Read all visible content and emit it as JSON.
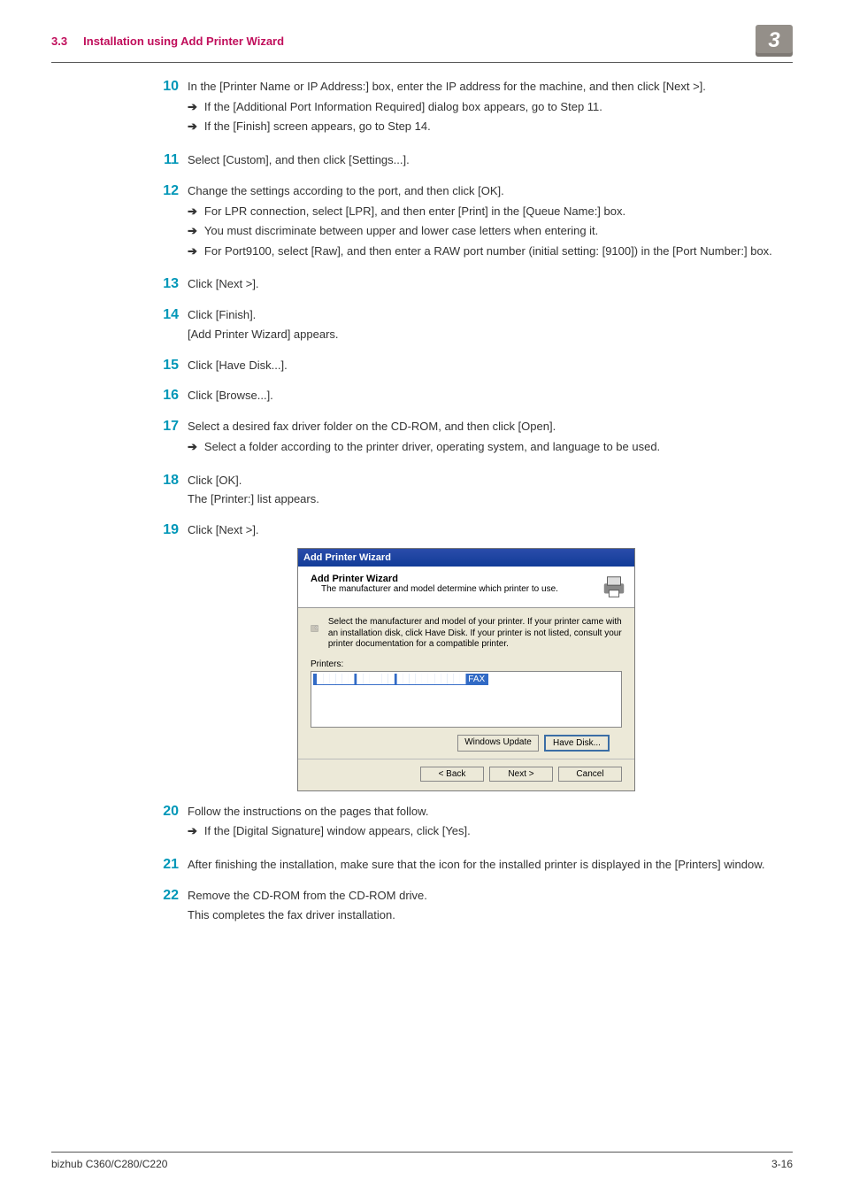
{
  "header": {
    "section_no": "3.3",
    "section_title": "Installation using Add Printer Wizard",
    "chapter": "3"
  },
  "steps": {
    "s10": {
      "num": "10",
      "text": "In the [Printer Name or IP Address:] box, enter the IP address for the machine, and then click [Next >].",
      "sub": [
        "If the [Additional Port Information Required] dialog box appears, go to Step 11.",
        "If the [Finish] screen appears, go to Step 14."
      ]
    },
    "s11": {
      "num": "11",
      "text": "Select [Custom], and then click [Settings...]."
    },
    "s12": {
      "num": "12",
      "text": "Change the settings according to the port, and then click [OK].",
      "sub": [
        "For LPR connection, select [LPR], and then enter [Print] in the [Queue Name:] box.",
        "You must discriminate between upper and lower case letters when entering it.",
        "For Port9100, select [Raw], and then enter a RAW port number (initial setting: [9100]) in the [Port Number:] box."
      ]
    },
    "s13": {
      "num": "13",
      "text": "Click [Next >]."
    },
    "s14": {
      "num": "14",
      "text": "Click [Finish].",
      "after": "[Add Printer Wizard] appears."
    },
    "s15": {
      "num": "15",
      "text": "Click [Have Disk...]."
    },
    "s16": {
      "num": "16",
      "text": "Click [Browse...]."
    },
    "s17": {
      "num": "17",
      "text": "Select a desired fax driver folder on the CD-ROM, and then click [Open].",
      "sub": [
        "Select a folder according to the printer driver, operating system, and language to be used."
      ]
    },
    "s18": {
      "num": "18",
      "text": "Click [OK].",
      "after": "The [Printer:] list appears."
    },
    "s19": {
      "num": "19",
      "text": "Click [Next >]."
    },
    "s20": {
      "num": "20",
      "text": "Follow the instructions on the pages that follow.",
      "sub": [
        "If the [Digital Signature] window appears, click [Yes]."
      ]
    },
    "s21": {
      "num": "21",
      "text": "After finishing the installation, make sure that the icon for the installed printer is displayed in the [Printers] window."
    },
    "s22": {
      "num": "22",
      "text": "Remove the CD-ROM from the CD-ROM drive.",
      "after": "This completes the fax driver installation."
    }
  },
  "dialog": {
    "title": "Add Printer Wizard",
    "banner_title": "Add Printer Wizard",
    "banner_sub": "The manufacturer and model determine which printer to use.",
    "instruction": "Select the manufacturer and model of your printer. If your printer came with an installation disk, click Have Disk. If your printer is not listed, consult your printer documentation for a compatible printer.",
    "printers_label": "Printers:",
    "selected_item": "██████ ██████ ███████████ FAX",
    "btn_windows_update": "Windows Update",
    "btn_have_disk": "Have Disk...",
    "btn_back": "< Back",
    "btn_next": "Next >",
    "btn_cancel": "Cancel"
  },
  "footer": {
    "left": "bizhub C360/C280/C220",
    "right": "3-16"
  }
}
